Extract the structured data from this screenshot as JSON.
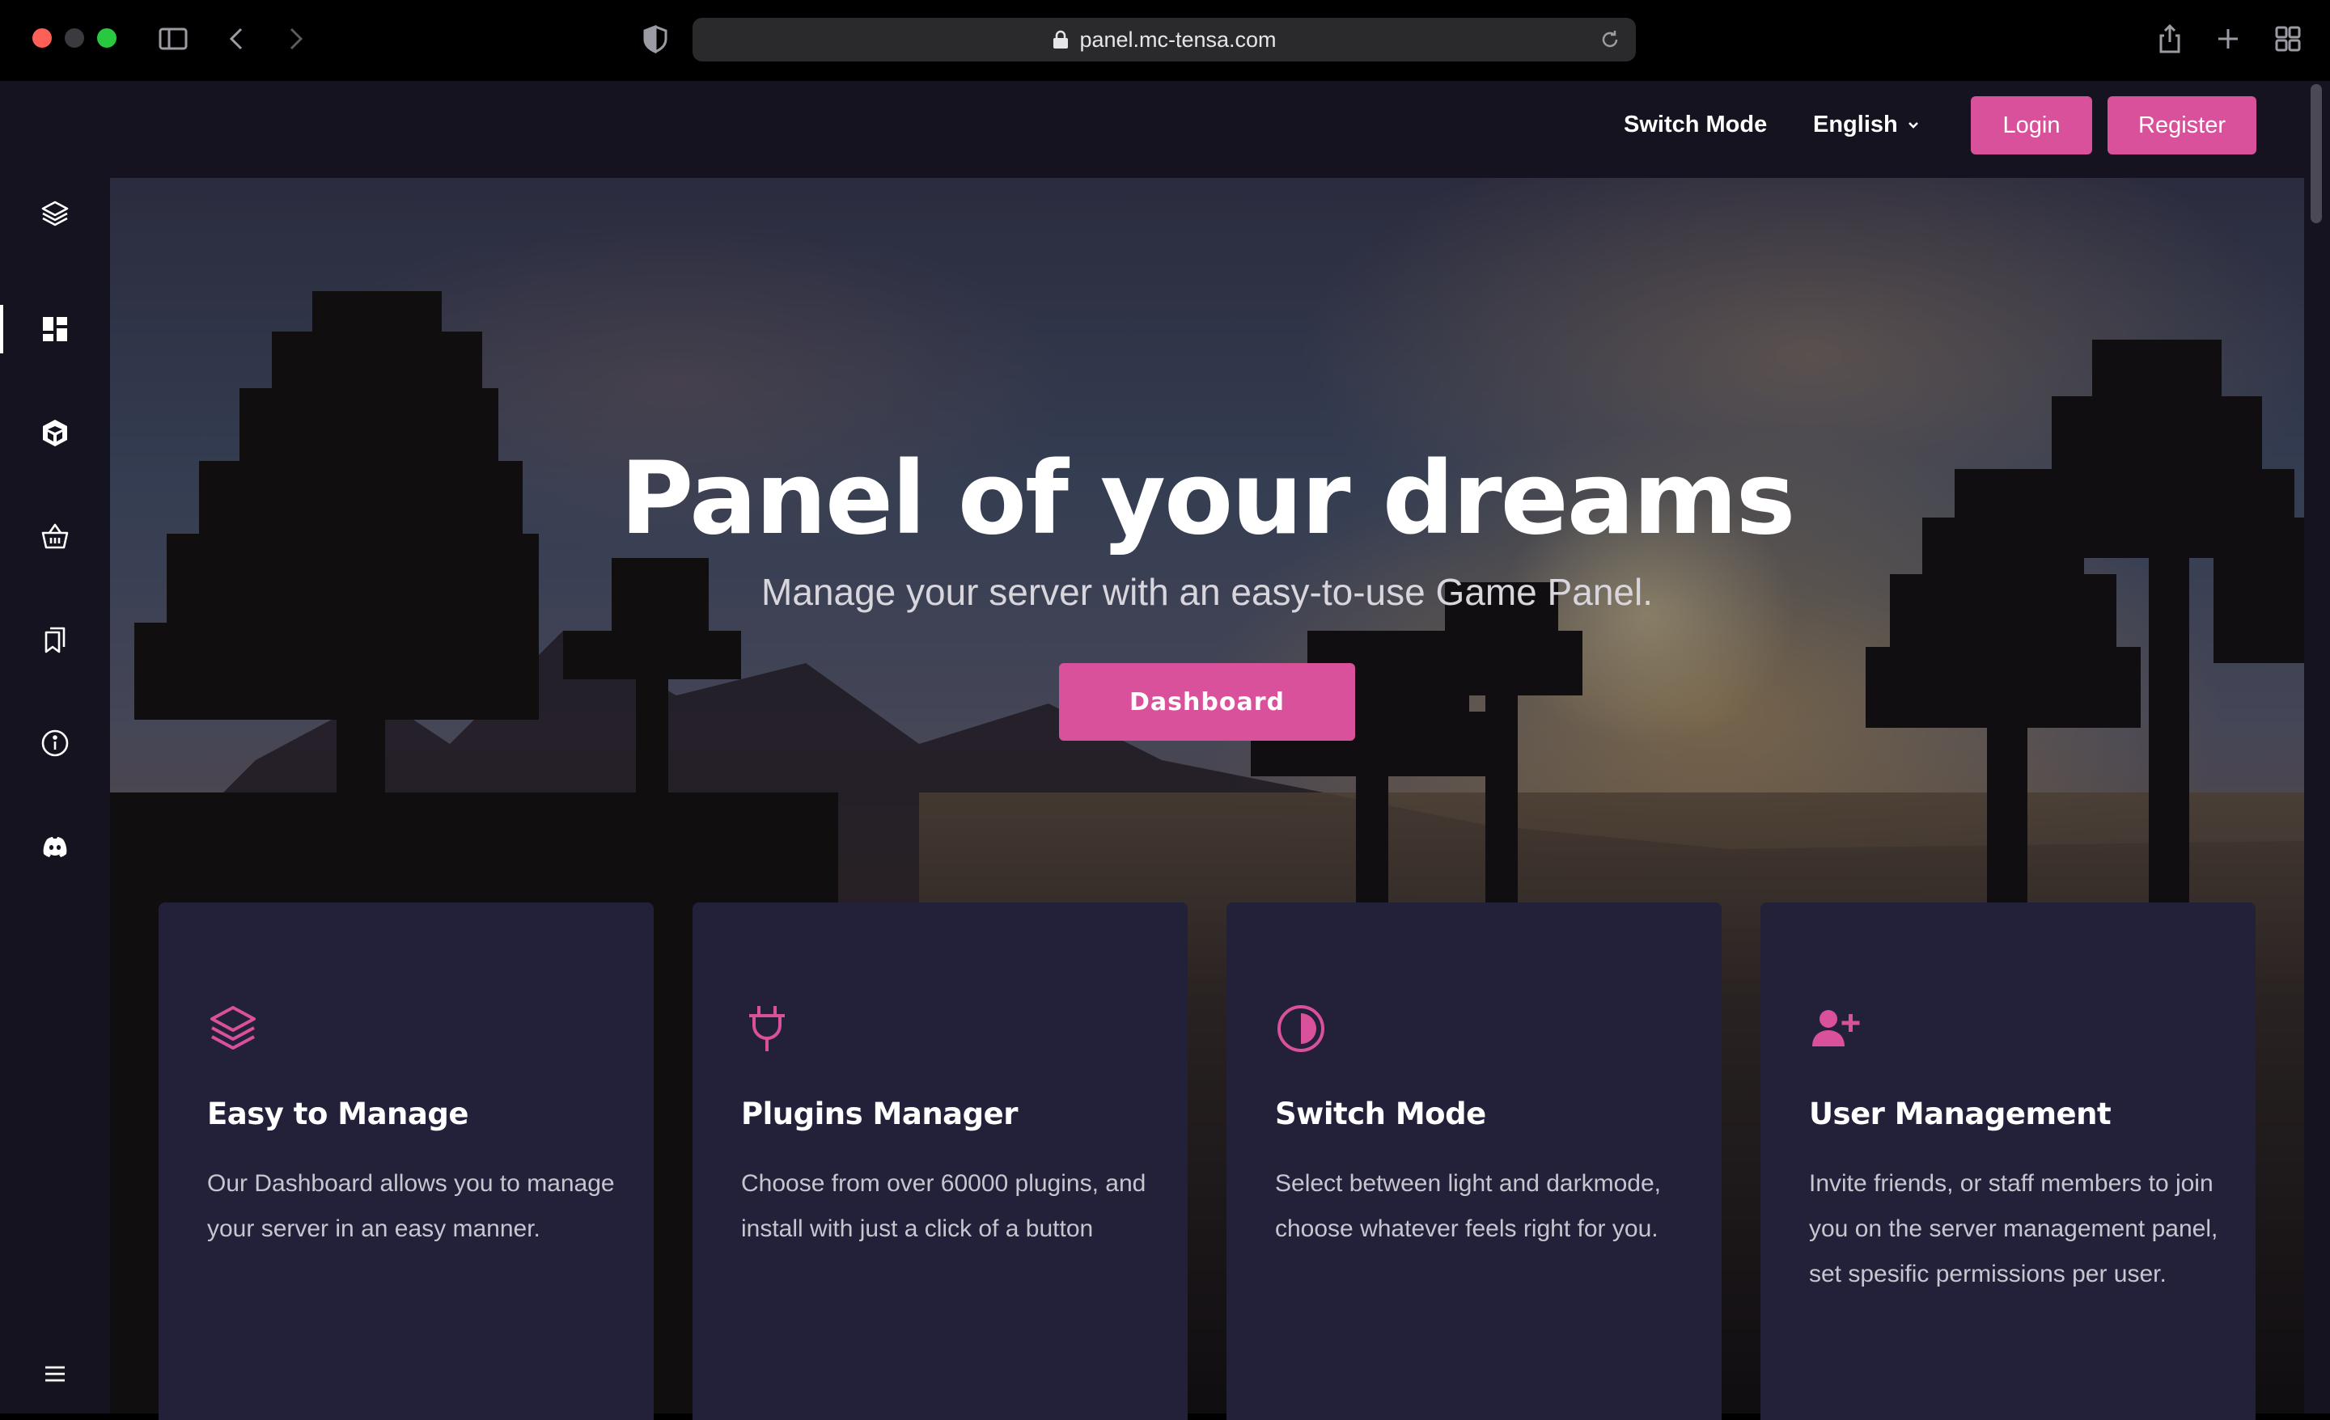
{
  "browser": {
    "url": "panel.mc-tensa.com"
  },
  "sidebar": {
    "items": [
      {
        "icon": "layers-icon"
      },
      {
        "icon": "dashboard-icon",
        "active": true
      },
      {
        "icon": "box-icon"
      },
      {
        "icon": "basket-icon"
      },
      {
        "icon": "bookmarks-icon"
      },
      {
        "icon": "info-icon"
      },
      {
        "icon": "discord-icon"
      },
      {
        "icon": "menu-icon"
      }
    ]
  },
  "nav": {
    "switch_mode": "Switch Mode",
    "language": "English",
    "login": "Login",
    "register": "Register"
  },
  "hero": {
    "title": "Panel of your dreams",
    "subtitle": "Manage your server with an easy-to-use Game Panel.",
    "cta": "Dashboard"
  },
  "features": [
    {
      "icon": "layers-icon",
      "title": "Easy to Manage",
      "text": "Our Dashboard allows you to manage your server in an easy manner."
    },
    {
      "icon": "plug-icon",
      "title": "Plugins Manager",
      "text": "Choose from over 60000 plugins, and install with just a click of a button"
    },
    {
      "icon": "contrast-icon",
      "title": "Switch Mode",
      "text": "Select between light and darkmode, choose whatever feels right for you."
    },
    {
      "icon": "user-plus-icon",
      "title": "User Management",
      "text": "Invite friends, or staff members to join you on the server management panel, set spesific permissions per user."
    }
  ],
  "colors": {
    "accent": "#d9519b",
    "panel": "#14131f",
    "card": "#23203a"
  }
}
